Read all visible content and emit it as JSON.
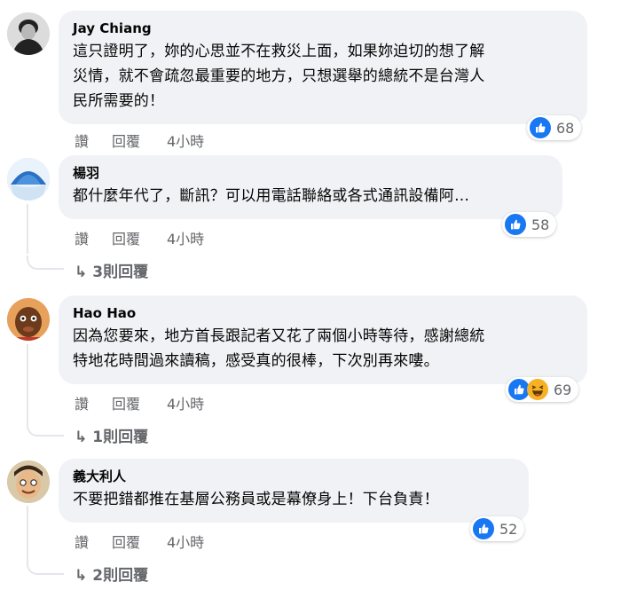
{
  "colors": {
    "like_blue": "#1877f2",
    "haha_yellow": "#f7b125",
    "bubble_bg": "#f0f2f5",
    "meta_gray": "#65676b"
  },
  "comments": [
    {
      "author": "Jay Chiang",
      "lines": [
        "這只證明了，妳的心思並不在救災上面，如果妳迫切的想了解",
        "災情，就不會疏忽最重要的地方，只想選舉的總統不是台灣人",
        "民所需要的！"
      ],
      "actions": {
        "like": "讚",
        "reply": "回覆",
        "time": "4小時"
      },
      "reactions": {
        "icons": [
          "like-icon"
        ],
        "count": "68"
      }
    },
    {
      "author": "楊羽",
      "lines": [
        "都什麼年代了，斷訊？可以用電話聯絡或各式通訊設備阿…"
      ],
      "actions": {
        "like": "讚",
        "reply": "回覆",
        "time": "4小時"
      },
      "reactions": {
        "icons": [
          "like-icon"
        ],
        "count": "58"
      },
      "replies": "3則回覆"
    },
    {
      "author": "Hao Hao",
      "lines": [
        "因為您要來，地方首長跟記者又花了兩個小時等待，感謝總統",
        "特地花時間過來讀稿，感受真的很棒，下次別再來嘍。"
      ],
      "actions": {
        "like": "讚",
        "reply": "回覆",
        "time": "4小時"
      },
      "reactions": {
        "icons": [
          "like-icon",
          "haha-icon"
        ],
        "count": "69"
      },
      "replies": "1則回覆"
    },
    {
      "author": "義大利人",
      "lines": [
        "不要把錯都推在基層公務員或是幕僚身上！下台負責！"
      ],
      "actions": {
        "like": "讚",
        "reply": "回覆",
        "time": "4小時"
      },
      "reactions": {
        "icons": [
          "like-icon"
        ],
        "count": "52"
      },
      "replies": "2則回覆"
    }
  ],
  "icons": {
    "reply_arrow": "↳"
  }
}
